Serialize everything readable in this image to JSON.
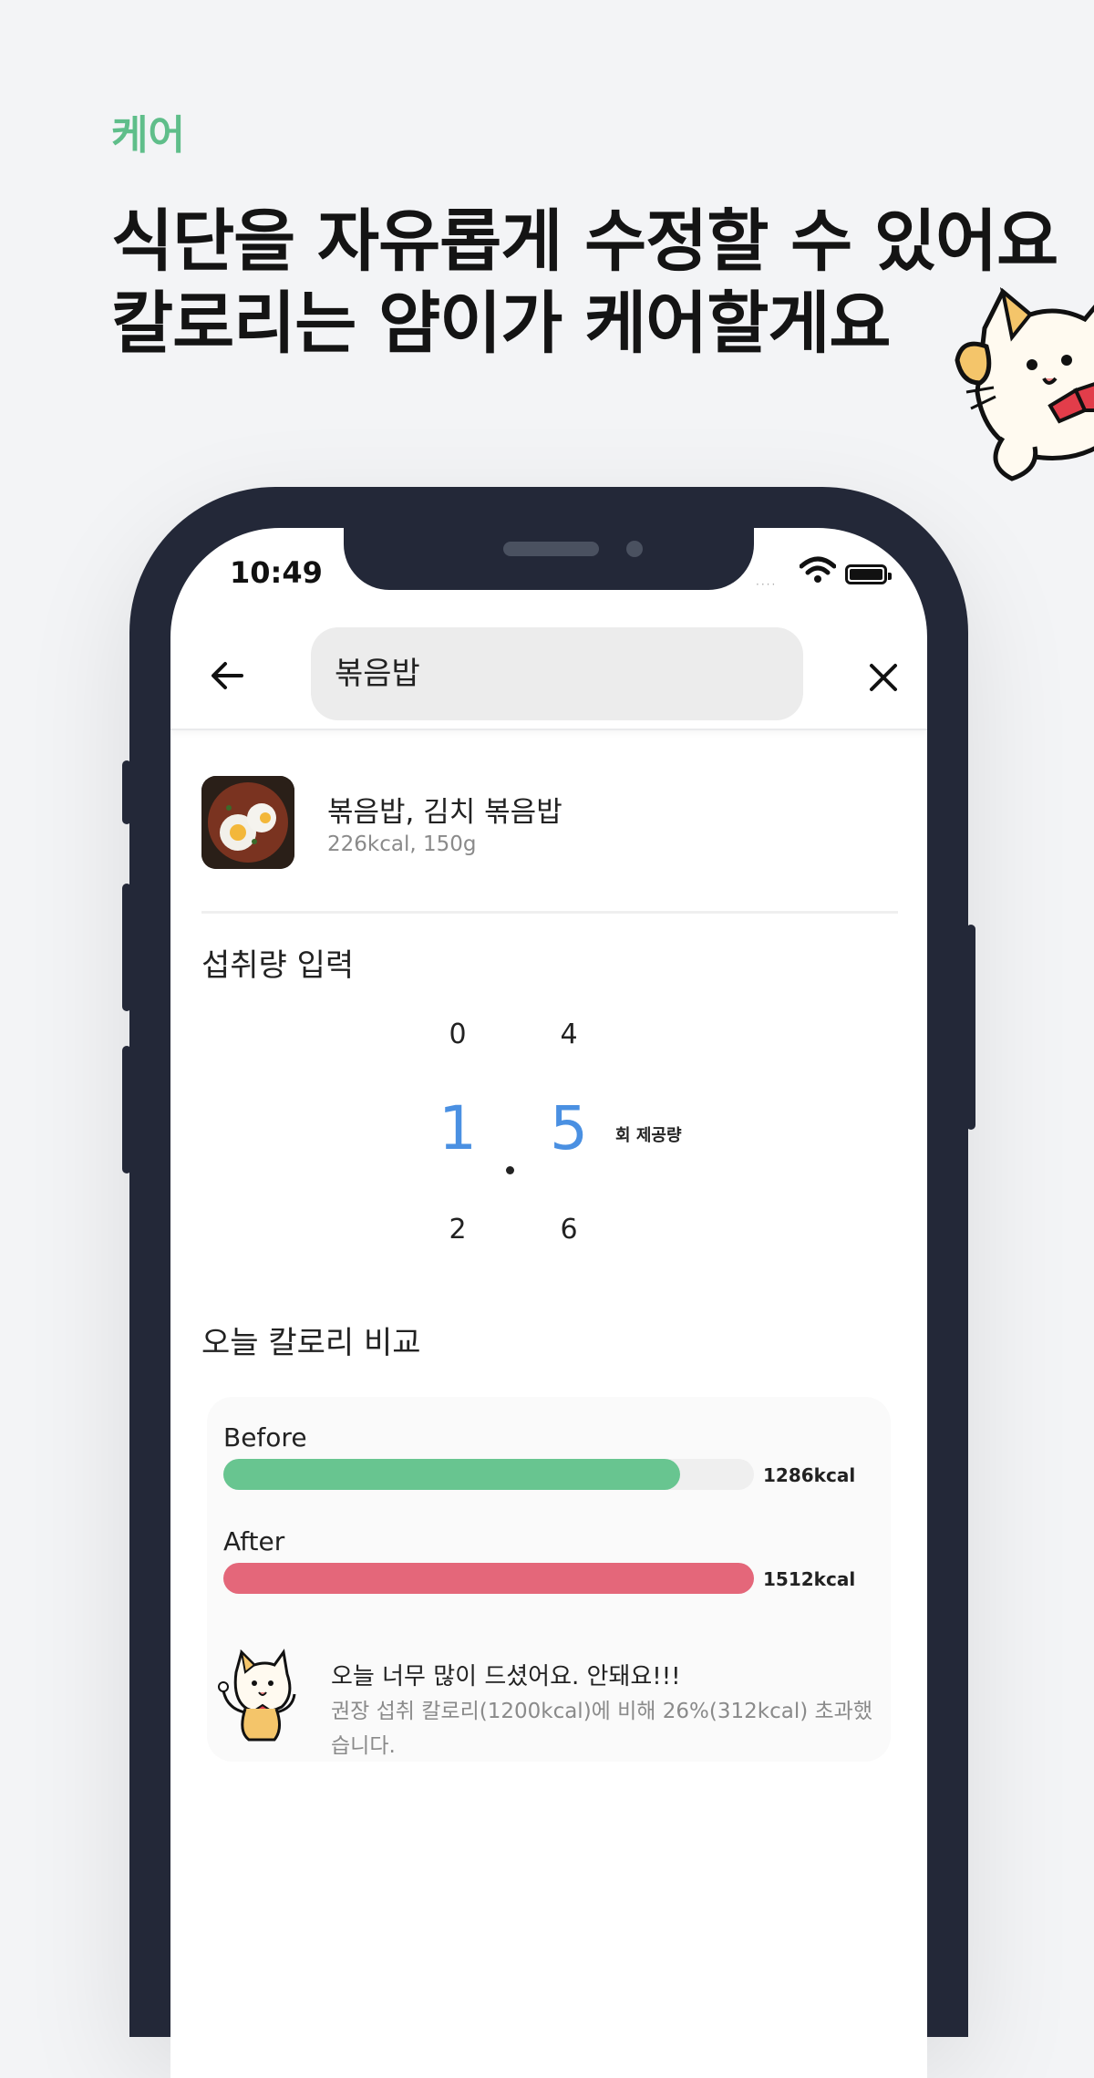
{
  "header": {
    "eyebrow": "케어",
    "headline_line1": "식단을 자유롭게 수정할 수 있어요",
    "headline_line2": "칼로리는 얌이가 케어할게요"
  },
  "status_bar": {
    "time": "10:49",
    "signal": "····"
  },
  "search": {
    "query": "볶음밥"
  },
  "food": {
    "name": "볶음밥, 김치 볶음밥",
    "detail": "226kcal, 150g"
  },
  "intake": {
    "title": "섭취량 입력",
    "integer_above": "0",
    "integer_selected": "1",
    "integer_below": "2",
    "decimal_above": "4",
    "decimal_selected": "5",
    "decimal_below": "6",
    "separator": ".",
    "unit": "회 제공량"
  },
  "compare": {
    "title": "오늘 칼로리 비교",
    "before_label": "Before",
    "before_value": "1286kcal",
    "before_fraction": 0.86,
    "after_label": "After",
    "after_value": "1512kcal",
    "after_fraction": 1.0,
    "colors": {
      "before": "#68c590",
      "after": "#e4677a"
    }
  },
  "message": {
    "title": "오늘 너무 많이 드셨어요. 안돼요!!!",
    "body": "권장 섭취 칼로리(1200kcal)에 비해 26%(312kcal) 초과했습니다."
  },
  "icons": [
    "back-arrow-icon",
    "close-icon",
    "wifi-icon",
    "battery-icon",
    "cat-mascot-icon"
  ]
}
